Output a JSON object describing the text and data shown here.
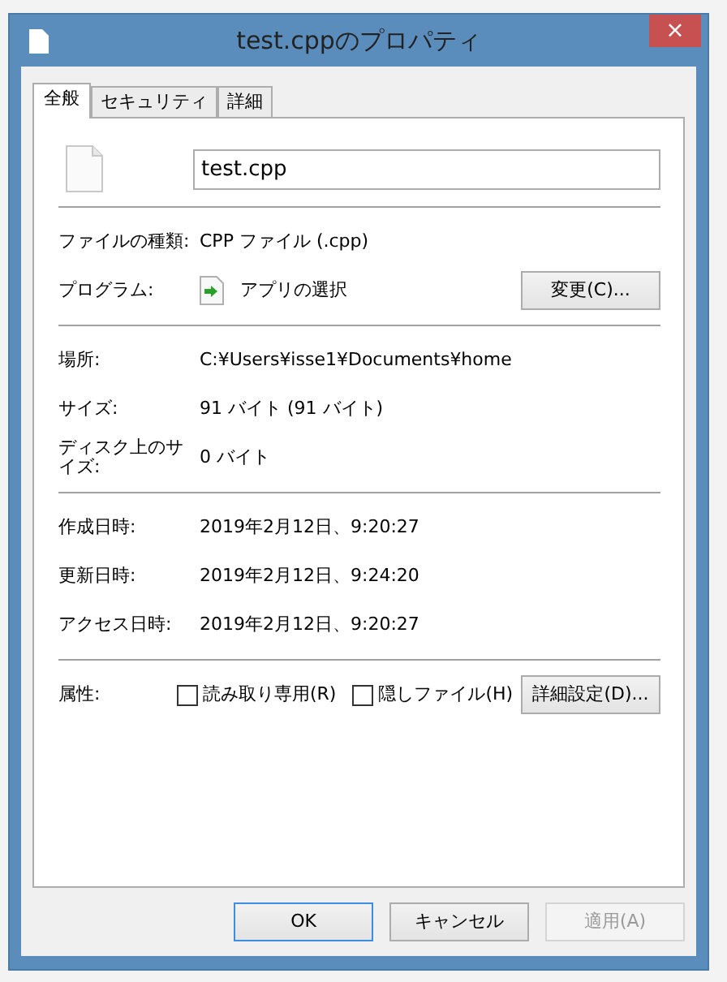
{
  "window": {
    "title": "test.cppのプロパティ",
    "close": "×"
  },
  "tabs": [
    {
      "label": "全般",
      "selected": true
    },
    {
      "label": "セキュリティ",
      "selected": false
    },
    {
      "label": "詳細",
      "selected": false
    }
  ],
  "file_name": {
    "value": "test.cpp"
  },
  "sections": [
    {
      "rows": [
        {
          "kind": "text",
          "label": "ファイルの種類:",
          "value": "CPP ファイル (.cpp)"
        },
        {
          "kind": "program",
          "label": "プログラム:",
          "value": "アプリの選択",
          "button": "変更(C)..."
        }
      ]
    },
    {
      "rows": [
        {
          "kind": "text",
          "label": "場所:",
          "value": "C:¥Users¥isse1¥Documents¥home"
        },
        {
          "kind": "text",
          "label": "サイズ:",
          "value": "91 バイト (91 バイト)"
        },
        {
          "kind": "text",
          "label": "ディスク上のサイズ:",
          "value": "0 バイト"
        }
      ]
    },
    {
      "rows": [
        {
          "kind": "text",
          "label": "作成日時:",
          "value": "2019年2月12日、9:20:27"
        },
        {
          "kind": "text",
          "label": "更新日時:",
          "value": "2019年2月12日、9:24:20"
        },
        {
          "kind": "text",
          "label": "アクセス日時:",
          "value": "2019年2月12日、9:20:27"
        }
      ]
    },
    {
      "rows": [
        {
          "kind": "attributes",
          "label": "属性:",
          "checkboxes": [
            {
              "label": "読み取り専用(R)",
              "checked": false
            },
            {
              "label": "隠しファイル(H)",
              "checked": false
            }
          ],
          "button": "詳細設定(D)..."
        }
      ]
    }
  ],
  "buttons": [
    {
      "label": "OK",
      "default": true,
      "disabled": false
    },
    {
      "label": "キャンセル",
      "default": false,
      "disabled": false
    },
    {
      "label": "適用(A)",
      "default": false,
      "disabled": true
    }
  ]
}
